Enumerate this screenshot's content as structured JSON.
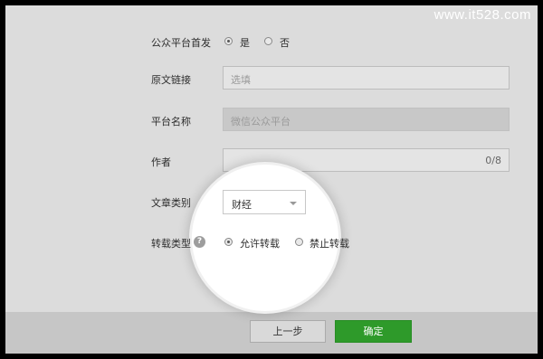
{
  "watermark": "www.it528.com",
  "form": {
    "first_publish": {
      "label": "公众平台首发",
      "options": [
        "是",
        "否"
      ],
      "selected": "是"
    },
    "source_link": {
      "label": "原文链接",
      "placeholder": "选填"
    },
    "platform_name": {
      "label": "平台名称",
      "value": "微信公众平台"
    },
    "author": {
      "label": "作者",
      "counter": "0/8"
    },
    "category": {
      "label": "文章类别",
      "selected": "财经"
    },
    "repost_type": {
      "label": "转载类型",
      "help": "?",
      "options": [
        "允许转载",
        "禁止转载"
      ],
      "selected": "允许转载"
    }
  },
  "footer": {
    "prev_label": "上一步",
    "confirm_label": "确定"
  }
}
